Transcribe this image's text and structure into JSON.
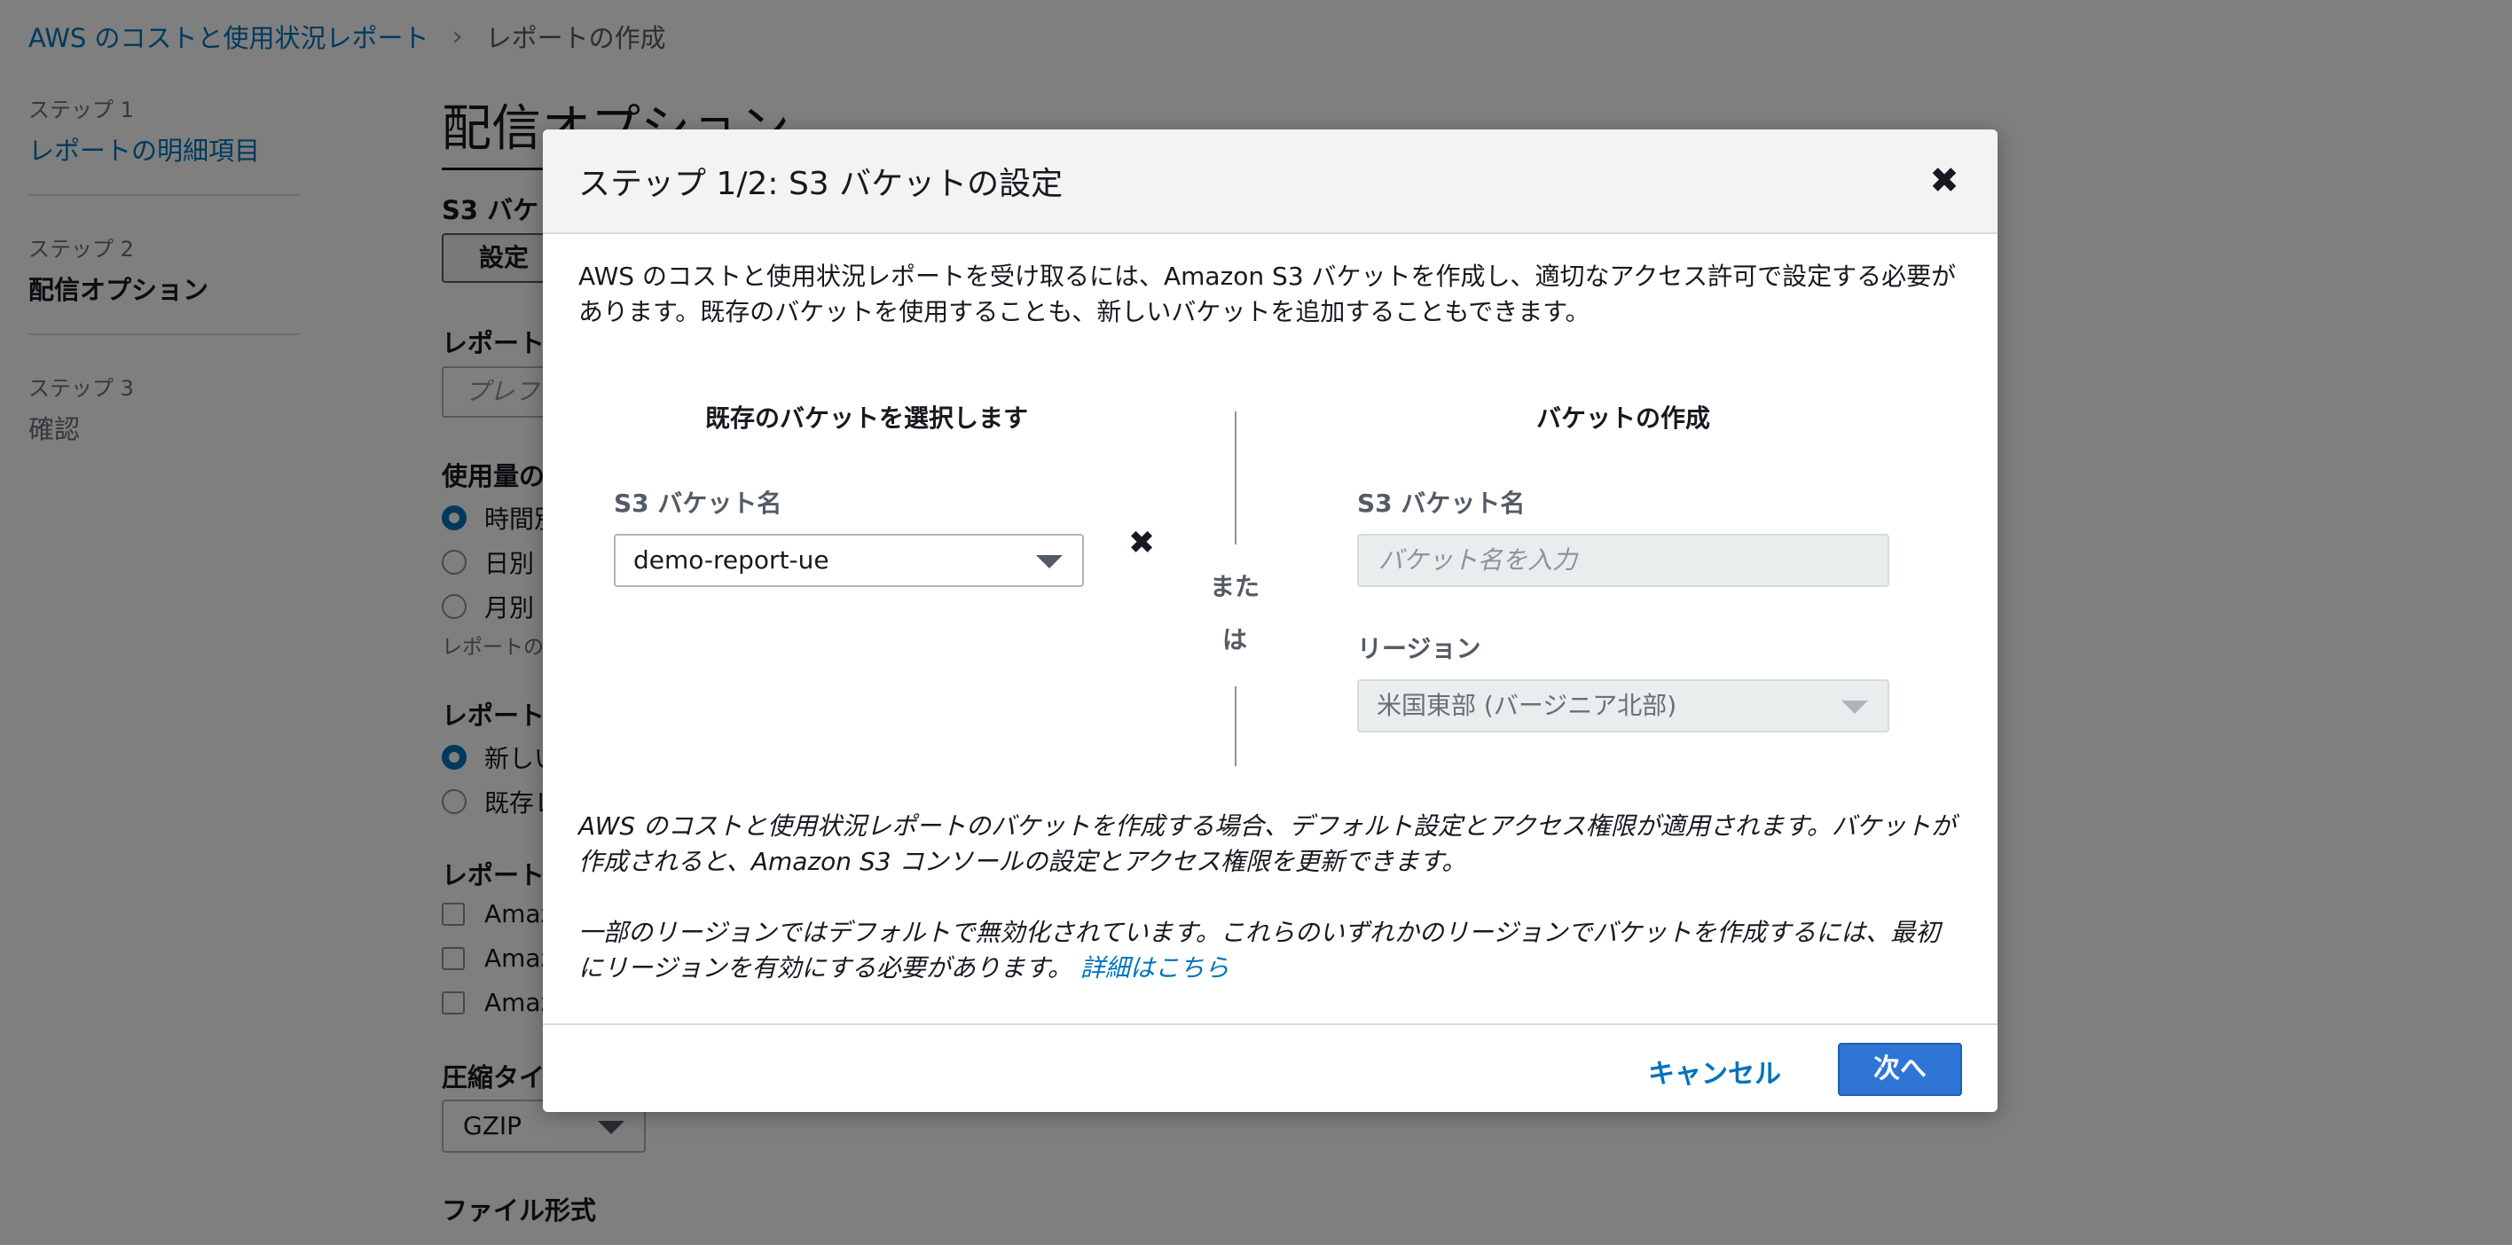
{
  "breadcrumb": {
    "root": "AWS のコストと使用状況レポート",
    "current": "レポートの作成"
  },
  "steps": [
    {
      "number": "ステップ 1",
      "title": "レポートの明細項目"
    },
    {
      "number": "ステップ 2",
      "title": "配信オプション"
    },
    {
      "number": "ステップ 3",
      "title": "確認"
    }
  ],
  "background": {
    "title": "配信オプション",
    "s3_bucket_label": "S3 バケッ",
    "configure_button": "設定",
    "report_prefix_label": "レポート",
    "prefix_placeholder": "プレフ",
    "usage_label": "使用量の",
    "time_radios": [
      "時間別",
      "日別",
      "月別"
    ],
    "time_hint": "レポートの",
    "report_version_label": "レポート",
    "version_radios": [
      "新しい",
      "既存レ"
    ],
    "integration_label": "レポート",
    "integration_checks": [
      "Amaz",
      "Amaz",
      "Amaz"
    ],
    "compression_label": "圧縮タイ",
    "compression_value": "GZIP",
    "file_format_label": "ファイル形式"
  },
  "modal": {
    "title": "ステップ 1/2: S3 バケットの設定",
    "intro": "AWS のコストと使用状況レポートを受け取るには、Amazon S3 バケットを作成し、適切なアクセス許可で設定する必要があります。既存のバケットを使用することも、新しいバケットを追加することもできます。",
    "existing": {
      "heading": "既存のバケットを選択します",
      "label": "S3 バケット名",
      "selected": "demo-report-ue"
    },
    "divider": [
      "また",
      "は"
    ],
    "create": {
      "heading": "バケットの作成",
      "name_label": "S3 バケット名",
      "name_placeholder": "バケット名を入力",
      "region_label": "リージョン",
      "region_value": "米国東部 (バージニア北部)"
    },
    "note1": "AWS のコストと使用状況レポートのバケットを作成する場合、デフォルト設定とアクセス権限が適用されます。バケットが作成されると、Amazon S3 コンソールの設定とアクセス権限を更新できます。",
    "note2": "一部のリージョンではデフォルトで無効化されています。これらのいずれかのリージョンでバケットを作成するには、最初にリージョンを有効にする必要があります。",
    "note2_link": "詳細はこちら",
    "cancel": "キャンセル",
    "next": "次へ"
  }
}
